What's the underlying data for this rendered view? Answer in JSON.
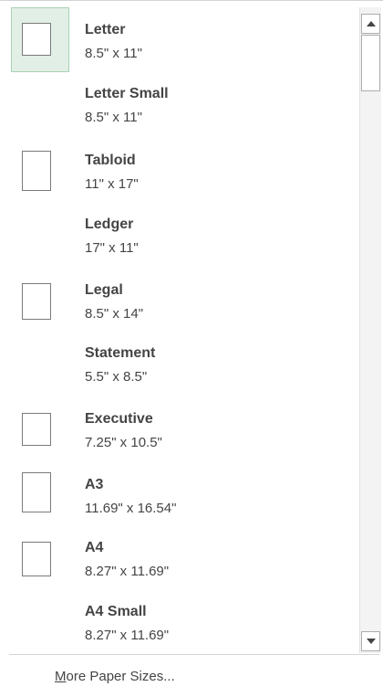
{
  "paper_sizes": [
    {
      "name": "Letter",
      "dims": "8.5\" x 11\"",
      "selected": true
    },
    {
      "name": "Letter Small",
      "dims": "8.5\" x 11\"",
      "selected": false
    },
    {
      "name": "Tabloid",
      "dims": "11\" x 17\"",
      "selected": false
    },
    {
      "name": "Ledger",
      "dims": "17\" x 11\"",
      "selected": false
    },
    {
      "name": "Legal",
      "dims": "8.5\" x 14\"",
      "selected": false
    },
    {
      "name": "Statement",
      "dims": "5.5\" x 8.5\"",
      "selected": false
    },
    {
      "name": "Executive",
      "dims": "7.25\" x 10.5\"",
      "selected": false
    },
    {
      "name": "A3",
      "dims": "11.69\" x 16.54\"",
      "selected": false
    },
    {
      "name": "A4",
      "dims": "8.27\" x 11.69\"",
      "selected": false
    },
    {
      "name": "A4 Small",
      "dims": "8.27\" x 11.69\"",
      "selected": false
    }
  ],
  "more_link": {
    "accel": "M",
    "rest": "ore Paper Sizes..."
  },
  "colors": {
    "selected_bg": "#e2efe6",
    "selected_border": "#a8d2b4",
    "text": "#444444"
  },
  "icons": {
    "scroll_up": "triangle-up-icon",
    "scroll_down": "triangle-down-icon",
    "page_thumb": "page-outline-icon"
  }
}
